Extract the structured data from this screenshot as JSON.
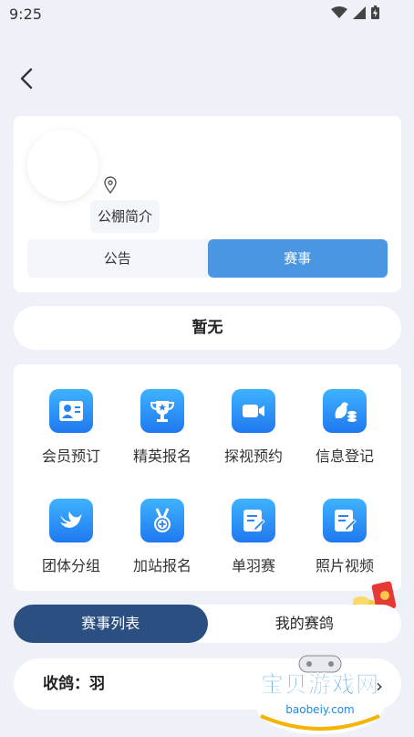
{
  "status_bar": {
    "time": "9:25"
  },
  "profile": {
    "intro_label": "公棚简介",
    "tabs": [
      {
        "label": "公告",
        "active": false
      },
      {
        "label": "赛事",
        "active": true
      }
    ]
  },
  "notice": {
    "text": "暂无"
  },
  "grid": [
    {
      "label": "会员预订",
      "icon": "member-card-icon"
    },
    {
      "label": "精英报名",
      "icon": "trophy-icon"
    },
    {
      "label": "探视预约",
      "icon": "video-camera-icon"
    },
    {
      "label": "信息登记",
      "icon": "pigeon-coins-icon"
    },
    {
      "label": "团体分组",
      "icon": "bird-icon"
    },
    {
      "label": "加站报名",
      "icon": "medal-plus-icon"
    },
    {
      "label": "单羽赛",
      "icon": "edit-document-icon"
    },
    {
      "label": "照片视频",
      "icon": "edit-document-icon"
    }
  ],
  "race_tabs": [
    {
      "label": "赛事列表",
      "active": true
    },
    {
      "label": "我的赛鸽",
      "active": false
    }
  ],
  "list": {
    "row_text": "收鸽：羽"
  },
  "watermark": {
    "title": "宝贝游戏网",
    "url": "baobeiy.com"
  },
  "colors": {
    "accent": "#4a96e2",
    "tab_active": "#2b4f80",
    "icon_gradient_top": "#3fb3ff",
    "icon_gradient_bottom": "#1f78ef"
  }
}
